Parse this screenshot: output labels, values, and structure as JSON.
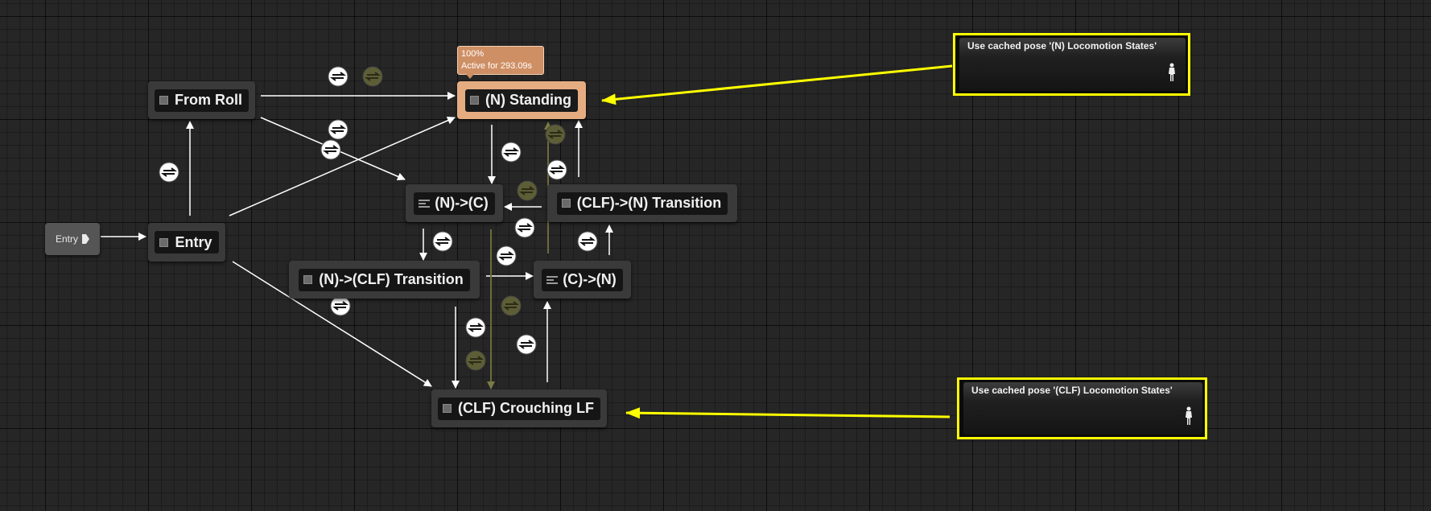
{
  "entry_node": {
    "label": "Entry"
  },
  "states": {
    "from_roll": "From Roll",
    "entry": "Entry",
    "n_standing": "(N) Standing",
    "n_to_c": "(N)->(C)",
    "clf_to_n": "(CLF)->(N) Transition",
    "n_to_clf": "(N)->(CLF) Transition",
    "c_to_n": "(C)->(N)",
    "clf_crouching": "(CLF) Crouching LF"
  },
  "active_tooltip": {
    "weight": "100%",
    "active_for": "Active for 293.09s"
  },
  "comments": [
    {
      "text": "Use cached pose '(N) Locomotion States'"
    },
    {
      "text": "Use cached pose '(CLF) Locomotion States'"
    }
  ],
  "colors": {
    "background": "#262626",
    "active_state": "#e5ac82",
    "comment_border": "#ffff00",
    "wire": "#ffffff",
    "inactive_wire": "#6b6b3c"
  }
}
